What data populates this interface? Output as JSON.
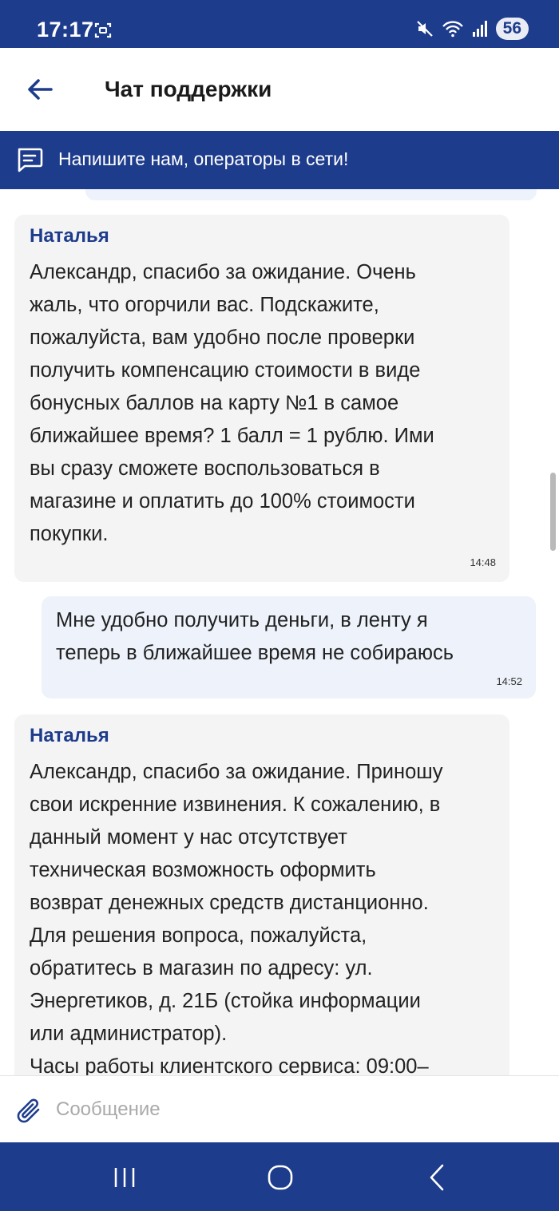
{
  "status_bar": {
    "time": "17:17",
    "battery": "56",
    "icons": [
      "screenshot-icon",
      "mute-icon",
      "wifi-icon",
      "signal-icon"
    ]
  },
  "header": {
    "title": "Чат поддержки",
    "back_icon": "arrow-left-icon"
  },
  "banner": {
    "icon": "chat-message-icon",
    "text": "Напишите нам, операторы в сети!"
  },
  "messages": [
    {
      "sender": "operator",
      "name": "Наталья",
      "text": "Александр, спасибо за ожидание. Очень\nжаль, что огорчили вас. Подскажите,\nпожалуйста, вам удобно после проверки\nполучить компенсацию стоимости в виде\nбонусных баллов на карту №1 в самое\nближайшее время? 1 балл = 1 рублю. Ими\nвы сразу сможете воспользоваться в\nмагазине и оплатить до 100% стоимости\nпокупки.",
      "time": "14:48"
    },
    {
      "sender": "user",
      "text": "Мне удобно получить деньги, в ленту я\nтеперь в ближайшее время не собираюсь",
      "time": "14:52"
    },
    {
      "sender": "operator",
      "name": "Наталья",
      "text": "Александр, спасибо за ожидание. Приношу\nсвои искренние извинения. К сожалению, в\nданный момент у нас отсутствует\nтехническая возможность оформить\nвозврат денежных средств дистанционно.\nДля решения вопроса, пожалуйста,\nобратитесь в магазин по адресу: ул.\nЭнергетиков, д. 21Б (стойка информации\nили администратор).\nЧасы работы клиентского сервиса: 09:00–"
    }
  ],
  "input": {
    "placeholder": "Сообщение",
    "value": "",
    "attach_icon": "paperclip-icon"
  },
  "nav_bar": {
    "buttons": [
      "recent-apps-icon",
      "home-icon",
      "back-icon"
    ]
  },
  "colors": {
    "brand": "#1e3c8c",
    "operator_bubble": "#f4f4f4",
    "user_bubble": "#edf2fb"
  }
}
